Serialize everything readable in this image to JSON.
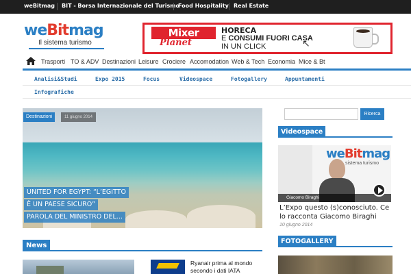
{
  "topbar": {
    "links": [
      "weBitmag",
      "BIT - Borsa Internazionale del Turismo",
      "Food Hospitality",
      "Real Estate"
    ]
  },
  "logo": {
    "we": "we",
    "bit": "Bit",
    "mag": "mag",
    "tagline": "Il sistema turismo"
  },
  "banner": {
    "brand_top": "Mixer",
    "brand_bottom": "Planet",
    "line1": "HORECA",
    "line2_prefix": "E ",
    "line2_bold": "CONSUMI FUORI CASA",
    "line3": "IN UN CLICK"
  },
  "mainnav": {
    "items": [
      "Trasporti",
      "TO & ADV",
      "Destinazioni",
      "Leisure",
      "Crociere",
      "Accomodation",
      "Web & Tech",
      "Economia",
      "Mice & Bt"
    ]
  },
  "subnav": {
    "items": [
      "Analisi&Studi",
      "Expo 2015",
      "Focus",
      "Videospace",
      "Fotogallery",
      "Appuntamenti",
      "Infografiche"
    ]
  },
  "hero": {
    "category": "Destinazioni",
    "date": "11 giugno 2014",
    "headline_lines": [
      "UNITED FOR EGYPT: “L’EGITTO",
      "È UN PAESE SICURO”",
      "PAROLA DEL MINISTRO DEL..."
    ]
  },
  "news": {
    "title": "News",
    "item2_text": "Ryanair prima al mondo secondo i dati IATA"
  },
  "sidebar": {
    "search_button": "Ricerca",
    "videospace_title": "Videospace",
    "video_person_name": "Giacomo Biraghi",
    "video_logo_tag": "sistema turismo",
    "video_title": "L’Expo questo (s)conosciuto. Ce lo racconta Giacomo Biraghi",
    "video_date": "10 giugno 2014",
    "fotogallery_title": "FOTOGALLERY"
  },
  "colors": {
    "accent": "#2b7fc4",
    "brand_red": "#e23c2e",
    "topbar_bg": "#1f1f1f"
  }
}
